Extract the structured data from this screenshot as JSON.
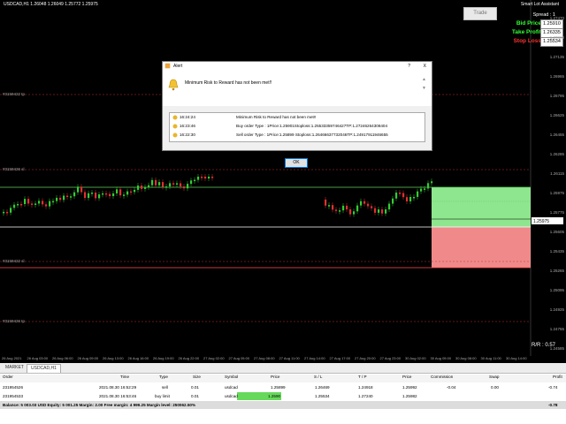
{
  "window": {
    "symbol_title": "USDCAD,H1  1.26048 1.26049 1.25772 1.25975",
    "top_info": "Smart Lot Assistant"
  },
  "panel": {
    "trade_label": "Trade",
    "spread_label": "Spread : 1",
    "bid_label": "Bid Price",
    "bid_value": "1.25910",
    "tp_label": "Take Profit",
    "tp_value": "1.26335",
    "sl_label": "Stop Loss",
    "sl_value": "1.25534",
    "colors": {
      "bid": "#33ff33",
      "tp": "#33ff33",
      "sl": "#ff3333"
    }
  },
  "chart": {
    "hline_labels": [
      "#3159422 tp",
      "#3159426 sl",
      "#3159422 sl",
      "#3159426 tp"
    ],
    "price_ticks": [
      "1.27470",
      "1.27300",
      "1.27135",
      "1.26965",
      "1.26795",
      "1.26625",
      "1.26455",
      "1.26285",
      "1.26115",
      "1.25975",
      "1.25775",
      "1.25605",
      "1.25435",
      "1.25265",
      "1.25095",
      "1.24925",
      "1.24755",
      "1.24585"
    ],
    "current_price": "1.25975",
    "date_ticks": [
      "26 Aug 2021",
      "26 Aug 03:00",
      "26 Aug 06:00",
      "26 Aug 09:00",
      "26 Aug 13:00",
      "26 Aug 16:00",
      "26 Aug 19:00",
      "26 Aug 22:00",
      "27 Aug 02:00",
      "27 Aug 05:00",
      "27 Aug 08:00",
      "27 Aug 11:00",
      "27 Aug 14:00",
      "27 Aug 17:00",
      "27 Aug 20:00",
      "27 Aug 23:00",
      "30 Aug 02:00",
      "30 Aug 05:00",
      "30 Aug 08:00",
      "30 Aug 11:00",
      "30 Aug 14:00"
    ],
    "rr_label": "R/R : 0.57"
  },
  "dialog": {
    "title": "Alert",
    "help": "?",
    "close": "X",
    "message": "Minimum Risk to Reward has not been met!!",
    "rows": [
      {
        "time": "16:24:24",
        "text": "Minimum Risk to Reward has not been met!!"
      },
      {
        "time": "16:23:46",
        "text": "Buy order Type : 1Price:1.25901Stoploss:1.25533359746427TP:1.27246264308404"
      },
      {
        "time": "16:22:30",
        "text": "Sell order Type : 1Price:1.25899 Stoploss:1.26466637732046TP:1.24917911946655"
      }
    ],
    "ok_label": "OK"
  },
  "terminal": {
    "tabs": [
      "MARKET",
      "USDCAD,H1"
    ],
    "headers": [
      "Order",
      "Time",
      "Type",
      "Size",
      "Symbol",
      "Price",
      "S / L",
      "T / P",
      "Price",
      "Commission",
      "Swap",
      "Profit"
    ],
    "rows": [
      [
        "231954526",
        "2021.08.30 16:52:29",
        "sell",
        "0.01",
        "usdcad",
        "1.25899",
        "1.26469",
        "1.24918",
        "1.25992",
        "-0.04",
        "0.00",
        "-0.74"
      ],
      [
        "231954533",
        "2021.08.30 16:53:46",
        "buy limit",
        "0.01",
        "usdcad",
        "1.2590",
        "1.25534",
        "1.27240",
        "1.25982",
        "",
        "",
        ""
      ]
    ],
    "balance_text": "Balance: 5 003.03 USD  Equity: 5 001.25  Margin: 2.00  Free margin: 4 999.25  Margin level: 250062.50%",
    "balance_profit": "-0.78"
  }
}
